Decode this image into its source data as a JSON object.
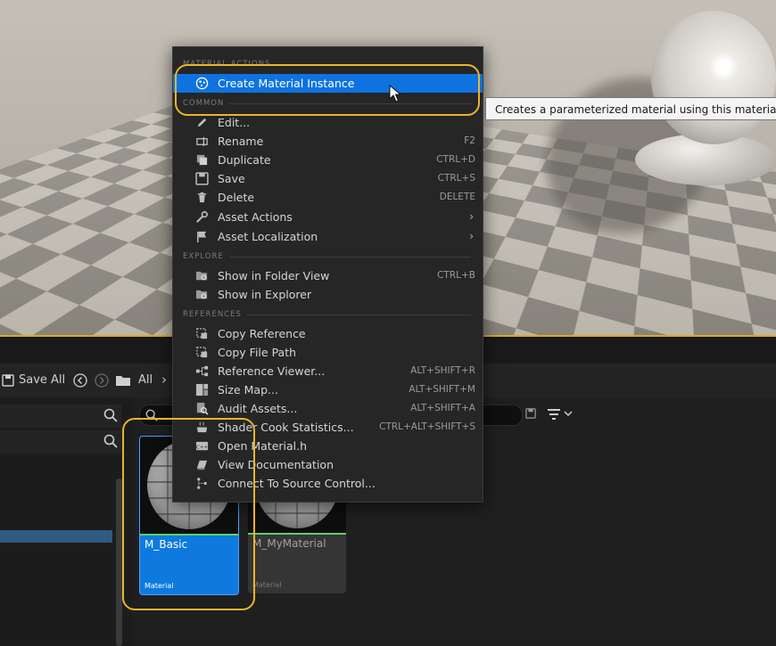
{
  "viewport": {
    "label": "Material preview viewport"
  },
  "toolbar": {
    "save_all": "Save All",
    "path_root": "All",
    "chevron": "›"
  },
  "menu": {
    "sections": {
      "material_actions": "MATERIAL ACTIONS",
      "common": "COMMON",
      "explore": "EXPLORE",
      "references": "REFERENCES"
    },
    "items": {
      "create_instance": {
        "label": "Create Material Instance"
      },
      "edit": {
        "label": "Edit..."
      },
      "rename": {
        "label": "Rename",
        "shortcut": "F2"
      },
      "duplicate": {
        "label": "Duplicate",
        "shortcut": "CTRL+D"
      },
      "save": {
        "label": "Save",
        "shortcut": "CTRL+S"
      },
      "delete": {
        "label": "Delete",
        "shortcut": "DELETE"
      },
      "asset_actions": {
        "label": "Asset Actions"
      },
      "asset_localization": {
        "label": "Asset Localization"
      },
      "show_folder": {
        "label": "Show in Folder View",
        "shortcut": "CTRL+B"
      },
      "show_explorer": {
        "label": "Show in Explorer"
      },
      "copy_reference": {
        "label": "Copy Reference"
      },
      "copy_file_path": {
        "label": "Copy File Path"
      },
      "reference_viewer": {
        "label": "Reference Viewer...",
        "shortcut": "ALT+SHIFT+R"
      },
      "size_map": {
        "label": "Size Map...",
        "shortcut": "ALT+SHIFT+M"
      },
      "audit_assets": {
        "label": "Audit Assets...",
        "shortcut": "ALT+SHIFT+A"
      },
      "shader_cook": {
        "label": "Shader Cook Statistics...",
        "shortcut": "CTRL+ALT+SHIFT+S"
      },
      "open_material_h": {
        "label": "Open Material.h"
      },
      "view_docs": {
        "label": "View Documentation"
      },
      "connect_source": {
        "label": "Connect To Source Control..."
      }
    }
  },
  "tooltip": {
    "text": "Creates a parameterized material using this material as a b"
  },
  "assets": [
    {
      "name": "M_Basic",
      "type": "Material"
    },
    {
      "name": "M_MyMaterial",
      "type": "Material"
    }
  ],
  "colors": {
    "accent": "#0e73e0",
    "highlight_ring": "#e8b52c",
    "viewport_border": "#d9a72b"
  }
}
